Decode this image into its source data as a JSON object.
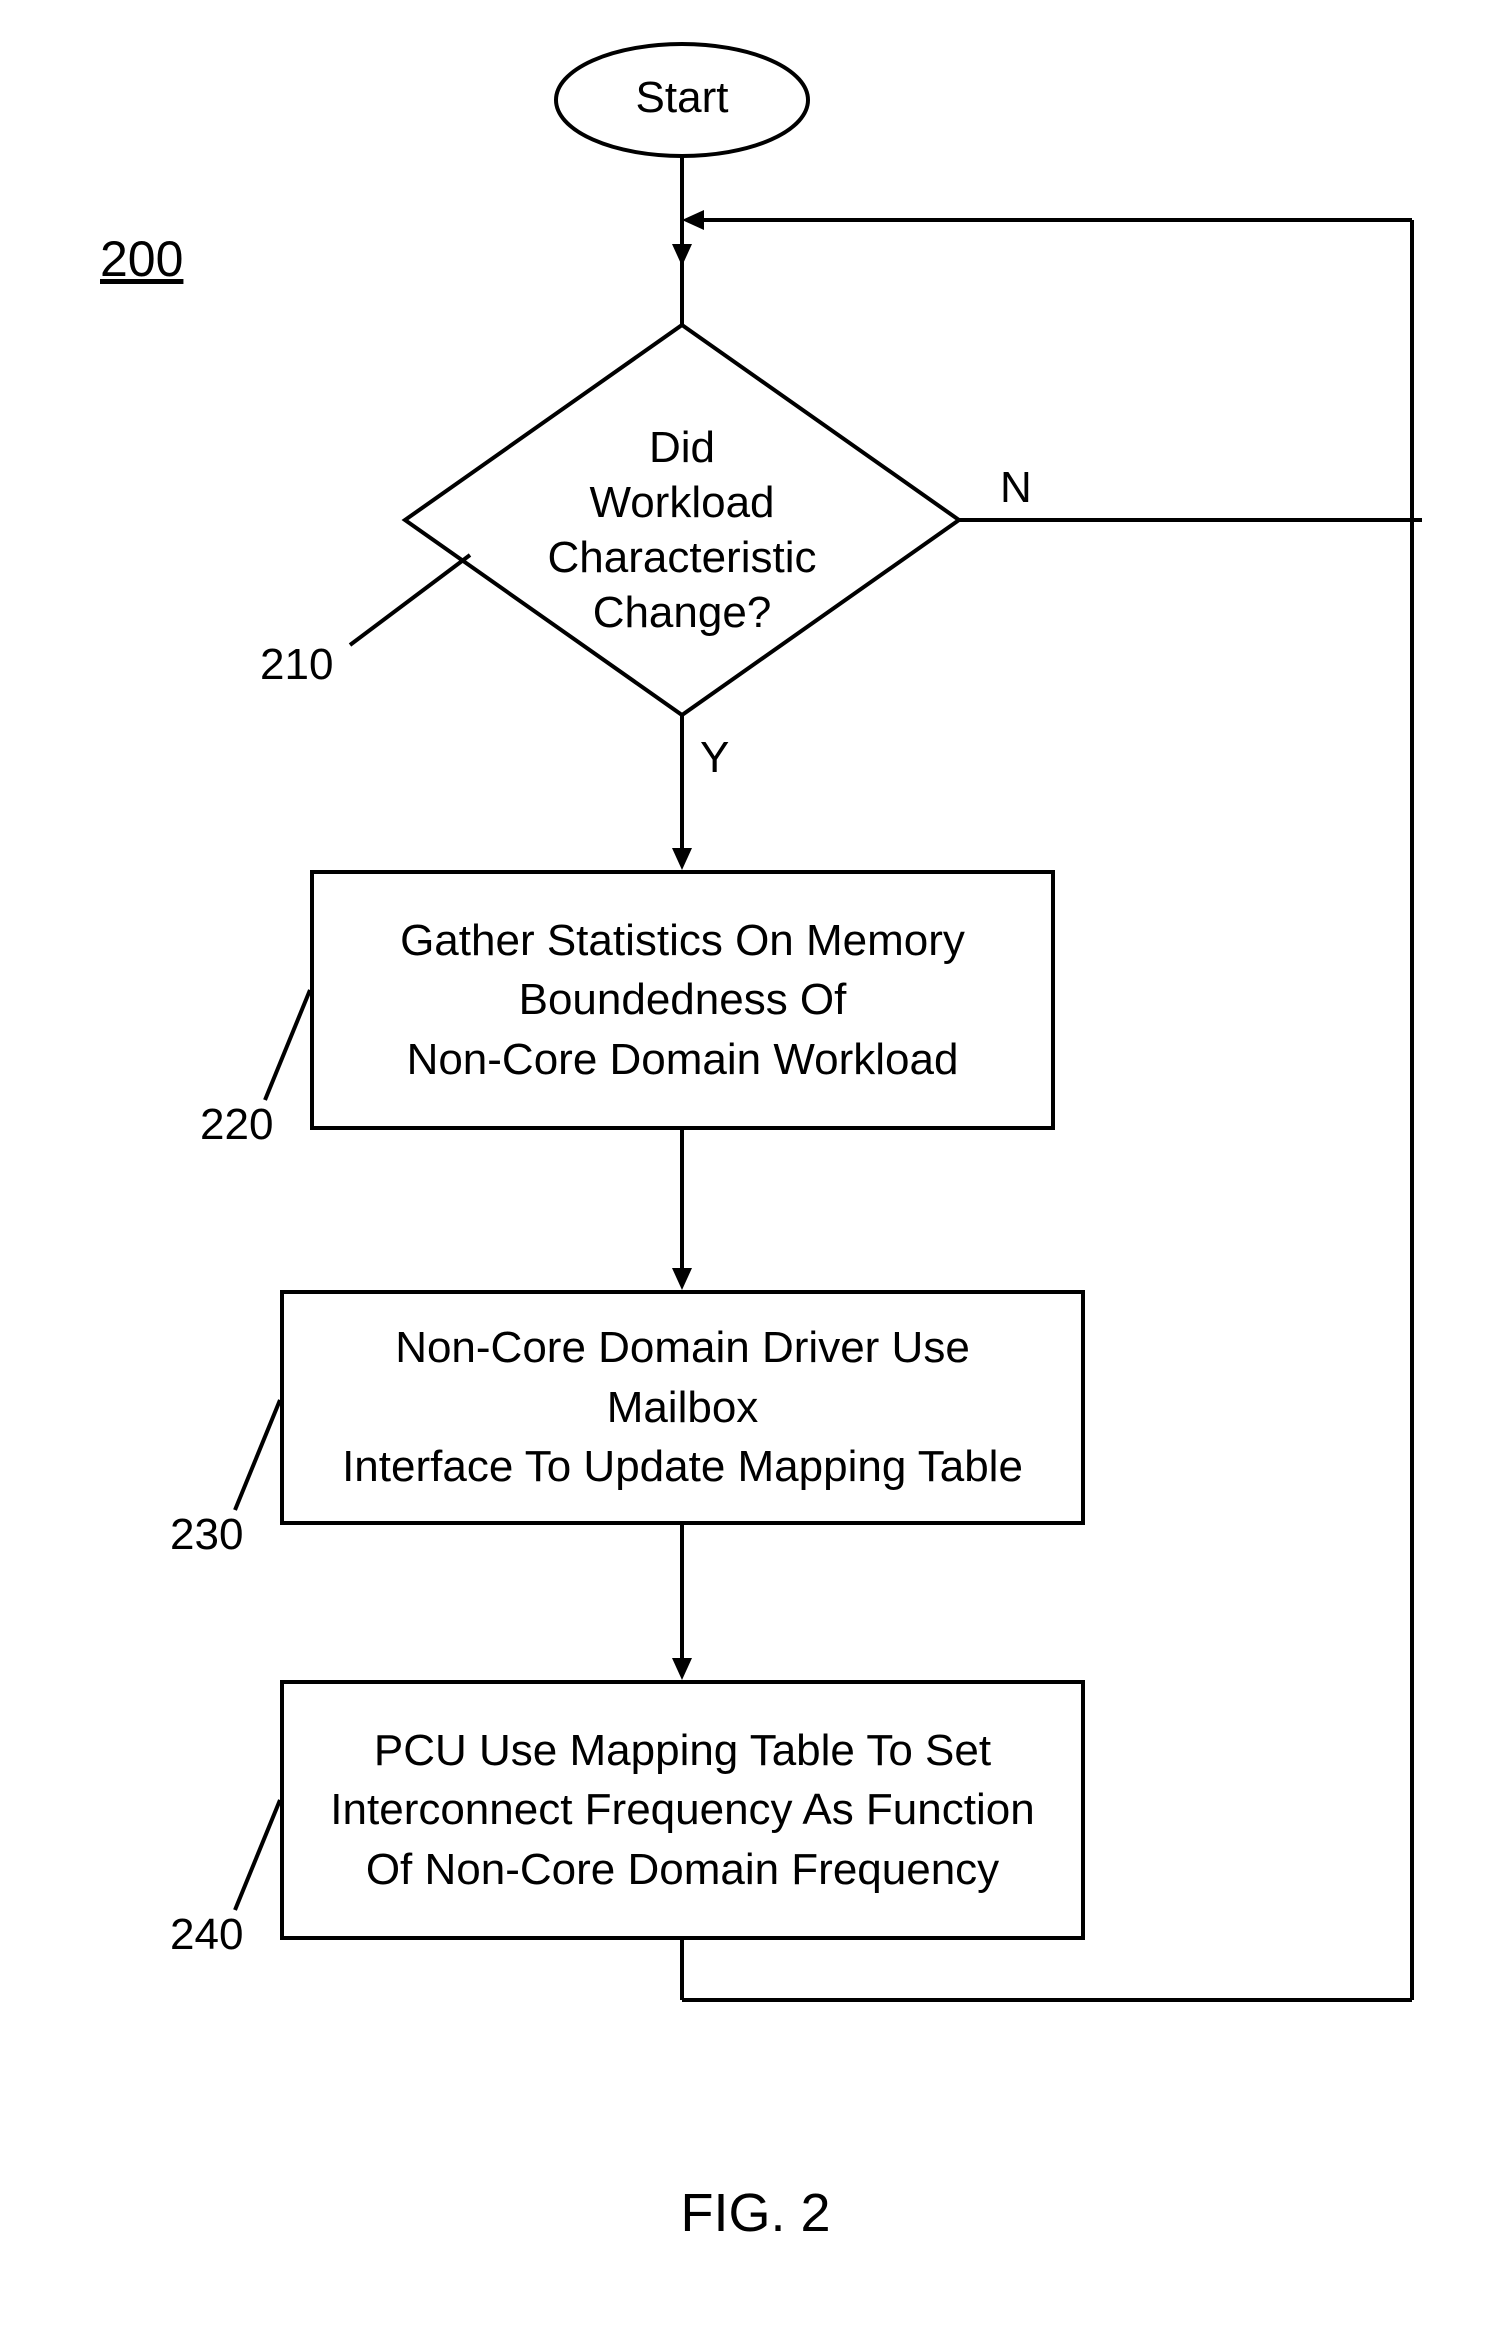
{
  "figure_ref": "200",
  "caption": "FIG. 2",
  "start": "Start",
  "decision": {
    "text": "Did\nWorkload\nCharacteristic\nChange?",
    "ref": "210",
    "yes": "Y",
    "no": "N"
  },
  "steps": [
    {
      "ref": "220",
      "text": "Gather Statistics On Memory\nBoundedness Of\nNon-Core Domain Workload"
    },
    {
      "ref": "230",
      "text": "Non-Core Domain Driver Use Mailbox\nInterface To Update Mapping Table"
    },
    {
      "ref": "240",
      "text": "PCU Use Mapping Table To Set\nInterconnect Frequency As Function\nOf Non-Core Domain Frequency"
    }
  ]
}
